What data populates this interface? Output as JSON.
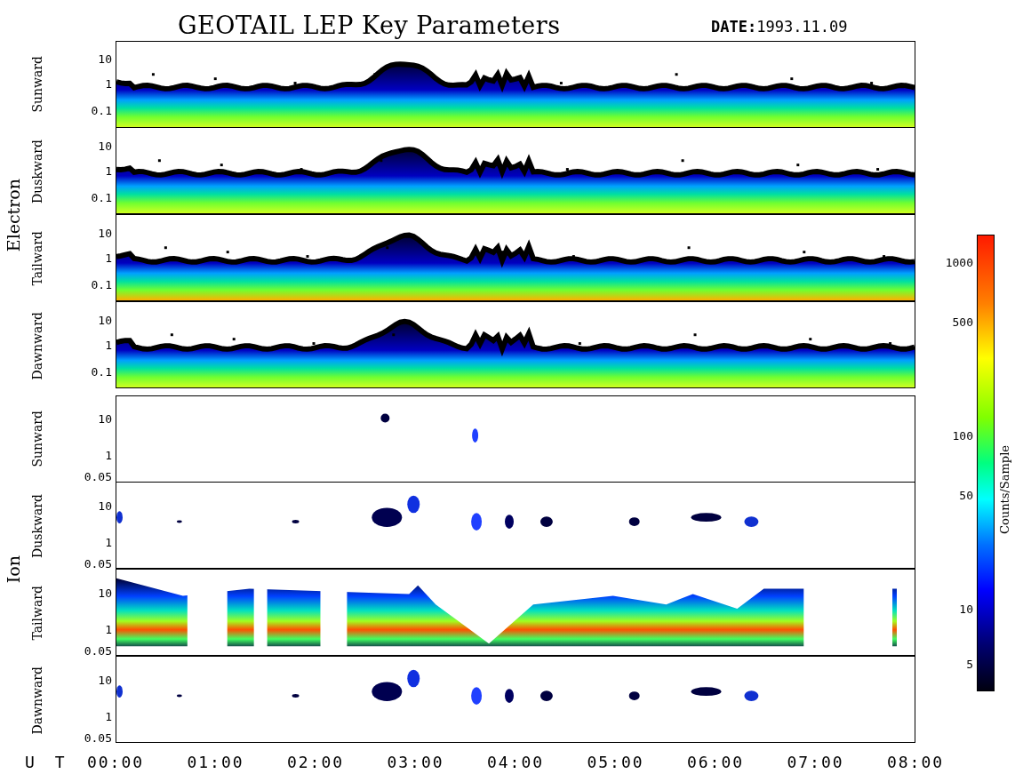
{
  "title": "GEOTAIL LEP Key Parameters",
  "date_label": "DATE:",
  "date": "1993.11.09",
  "groups": [
    {
      "name": "Electron",
      "panels": [
        {
          "label": "Sunward",
          "kind": "band",
          "yticks": [
            "10",
            "1",
            "0.1"
          ]
        },
        {
          "label": "Duskward",
          "kind": "band",
          "yticks": [
            "10",
            "1",
            "0.1"
          ]
        },
        {
          "label": "Tailward",
          "kind": "band",
          "yticks": [
            "10",
            "1",
            "0.1"
          ]
        },
        {
          "label": "Dawnward",
          "kind": "band",
          "yticks": [
            "10",
            "1",
            "0.1"
          ]
        }
      ]
    },
    {
      "name": "Ion",
      "panels": [
        {
          "label": "Sunward",
          "kind": "sparse",
          "yticks": [
            "10",
            "1",
            "0.05"
          ]
        },
        {
          "label": "Duskward",
          "kind": "patches",
          "yticks": [
            "10",
            "1",
            "0.05"
          ]
        },
        {
          "label": "Tailward",
          "kind": "filled",
          "yticks": [
            "10",
            "1",
            "0.05"
          ]
        },
        {
          "label": "Dawnward",
          "kind": "patches",
          "yticks": [
            "10",
            "1",
            "0.05"
          ]
        }
      ]
    }
  ],
  "x_axis": {
    "label": "U T",
    "ticks": [
      "00:00",
      "01:00",
      "02:00",
      "03:00",
      "04:00",
      "05:00",
      "06:00",
      "07:00",
      "08:00"
    ]
  },
  "colorbar": {
    "title": "Counts/Sample",
    "ticks": [
      "1000",
      "500",
      "100",
      "50",
      "10",
      "5"
    ]
  }
}
